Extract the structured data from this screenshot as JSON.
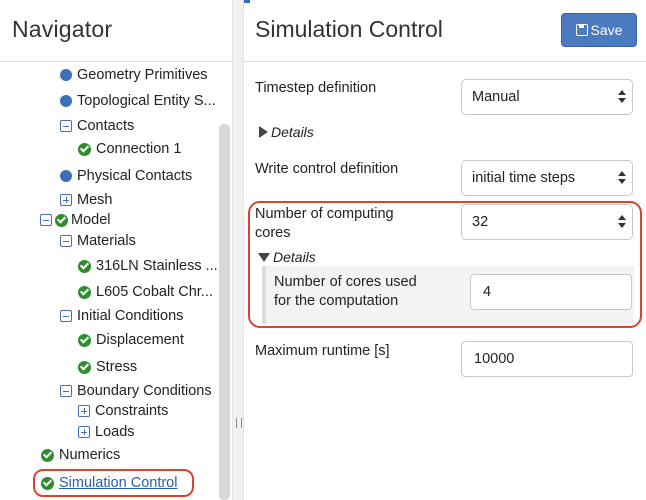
{
  "navigator": {
    "title": "Navigator",
    "tree": [
      {
        "label": "Geometry Primitives",
        "icon": "circle-dot-icon"
      },
      {
        "label": "Topological Entity S...",
        "icon": "circle-dot-icon"
      },
      {
        "label": "Contacts",
        "icon": "collapse-icon"
      },
      {
        "label": "Connection 1",
        "icon": "check-circle-icon"
      },
      {
        "label": "Physical Contacts",
        "icon": "circle-dot-icon"
      },
      {
        "label": "Mesh",
        "icon": "expand-icon"
      },
      {
        "label": "Model",
        "icon": "check-circle-icon"
      },
      {
        "label": "Materials",
        "icon": "collapse-icon"
      },
      {
        "label": "316LN Stainless ...",
        "icon": "check-circle-icon"
      },
      {
        "label": "L605 Cobalt Chr...",
        "icon": "check-circle-icon"
      },
      {
        "label": "Initial Conditions",
        "icon": "collapse-icon"
      },
      {
        "label": "Displacement",
        "icon": "check-circle-icon"
      },
      {
        "label": "Stress",
        "icon": "check-circle-icon"
      },
      {
        "label": "Boundary Conditions",
        "icon": "collapse-icon"
      },
      {
        "label": "Constraints",
        "icon": "expand-icon"
      },
      {
        "label": "Loads",
        "icon": "expand-icon"
      },
      {
        "label": "Numerics",
        "icon": "check-circle-icon"
      },
      {
        "label": "Simulation Control",
        "icon": "check-circle-icon"
      }
    ]
  },
  "main": {
    "title": "Simulation Control",
    "save_label": "Save",
    "timestep_label": "Timestep definition",
    "timestep_value": "Manual",
    "details_label": "Details",
    "write_control_label": "Write control definition",
    "write_control_value": "initial time steps",
    "computing_cores_label_line1": "Number of computing",
    "computing_cores_label_line2": "cores",
    "computing_cores_value": "32",
    "details2_label": "Details",
    "cores_used_label_line1": "Number of cores used",
    "cores_used_label_line2": "for the computation",
    "cores_used_value": "4",
    "max_runtime_label": "Maximum runtime [s]",
    "max_runtime_value": "10000"
  },
  "colors": {
    "accent": "#4a7bbf",
    "highlight": "#d9432f",
    "success": "#2f8c2f",
    "link": "#2b5ea8"
  }
}
